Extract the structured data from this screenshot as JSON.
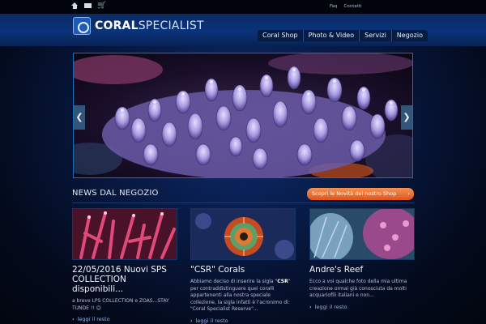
{
  "top_links": {
    "faq": "Faq",
    "contacts": "Contatti"
  },
  "search": {
    "placeholder": ""
  },
  "logo": {
    "part1": "CORAL",
    "part2": "SPECIALIST"
  },
  "nav": [
    "Coral Shop",
    "Photo & Video",
    "Servizi",
    "Negozio"
  ],
  "slider": {
    "prev": "❮",
    "next": "❯"
  },
  "news": {
    "title": "NEWS DAL NEGOZIO",
    "cta": "Scopri le Novità del nostro Shop",
    "cta_arrow": "›"
  },
  "cards": [
    {
      "title": "22/05/2016 Nuovi SPS COLLECTION disponibili...",
      "text": "a breve LPS COLLECTION e ZOAS...STAY TUNDE !! 😊",
      "more": "leggi il resto"
    },
    {
      "title": "\"CSR\" Corals",
      "text_pre": "Abbiamo deciso di inserire la sigla \"",
      "text_strong": "CSR",
      "text_post": "\" per contraddistinguere quei coralli appartenenti alla nostra speciale collezione, la sigla infatti è l'acronimo di: \"Coral Specialist Reserve\"...",
      "more": "leggi il resto"
    },
    {
      "title": "Andre's Reef",
      "text": "Ecco a voi qualche foto della mia ultima creazione ormai già conosciuta da molti acquariofili italiani e non...",
      "more": "leggi il resto"
    }
  ],
  "colors": {
    "accent": "#e86a2a",
    "nav_bg": "#061c44",
    "link": "#8fb6ea"
  },
  "icons": [
    "home-icon",
    "mail-icon",
    "cart-icon",
    "chevron-left-icon",
    "chevron-right-icon",
    "chevron-right-small-icon"
  ]
}
